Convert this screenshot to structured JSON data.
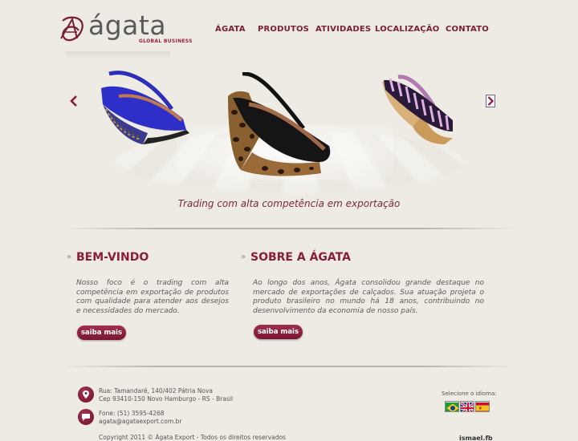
{
  "brand": {
    "name": "ágata",
    "tagline": "GLOBAL BUSINESS",
    "accent_color": "#8a1d38"
  },
  "nav": {
    "items": [
      {
        "label": "ÁGATA"
      },
      {
        "label": "PRODUTOS"
      },
      {
        "label": "ATIVIDADES"
      },
      {
        "label": "LOCALIZAÇÃO"
      },
      {
        "label": "CONTATO"
      }
    ]
  },
  "carousel": {
    "tagline": "Trading com alta competência em exportação",
    "prev_icon": "chevron-left-icon",
    "next_icon": "chevron-right-icon",
    "slides": [
      {
        "name": "blue-wedge-sandal"
      },
      {
        "name": "leopard-wedge-sandal"
      },
      {
        "name": "striped-wedge-sandal"
      }
    ]
  },
  "welcome": {
    "title": "BEM-VINDO",
    "text": "Nosso foco é o trading com alta competência em exportação de produtos com qualidade para atender aos desejos e necessidades do mercado.",
    "button": "saiba mais"
  },
  "about": {
    "title": "SOBRE A ÁGATA",
    "text": "Ao longo dos anos, Ágata consolidou grande destaque no mercado de exportações de calçados. Sua atuação projeta o produto brasileiro no mundo há 18 anos, contribuindo no desenvolvimento da economia de nosso país.",
    "button": "saiba mais"
  },
  "footer": {
    "address_line1": "Rua: Tamandaré, 140/402 Pátria Nova",
    "address_line2": "Cep 93410-150 Novo Hamburgo - RS - Brasil",
    "phone": "Fone: (51) 3595-4268",
    "email": "agata@agataexport.com.br",
    "copyright": "Copyright 2011 © Ágata Export - Todos os direitos reservados",
    "language_label": "Selecione o idioma:",
    "languages": [
      {
        "icon": "brazil-flag-icon"
      },
      {
        "icon": "uk-flag-icon"
      },
      {
        "icon": "spain-flag-icon"
      }
    ],
    "credit": "ismael.fb"
  }
}
